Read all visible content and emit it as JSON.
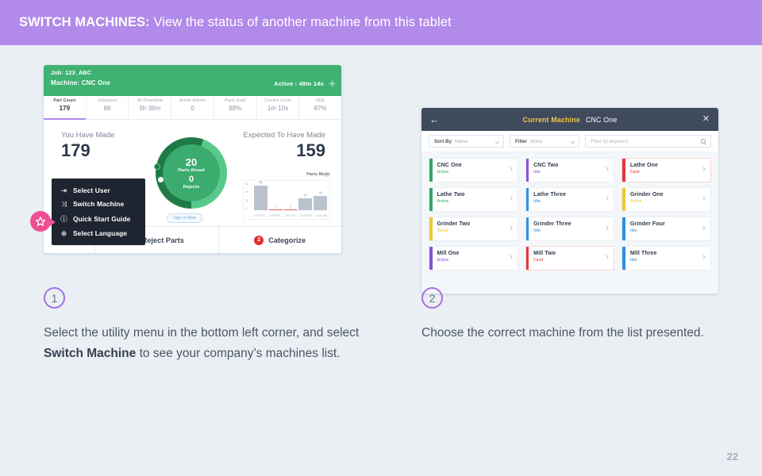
{
  "banner": {
    "strong": "SWITCH MACHINES:",
    "rest": " View the status of another machine from this tablet",
    "bg_color": "#b28ae9"
  },
  "page_number": "22",
  "left_screenshot": {
    "header": {
      "job": "Job: 123_ABC",
      "machine": "Machine: CNC One",
      "active": "Active : 48m 14s",
      "bg_color": "#3fb272"
    },
    "kpis": [
      {
        "label": "Part Count",
        "value": "179",
        "active": true
      },
      {
        "label": "Utilization",
        "value": "86",
        "active": false
      },
      {
        "label": "All Downtime",
        "value": "5h 36m",
        "active": false
      },
      {
        "label": "Active Alarms",
        "value": "0",
        "active": false
      },
      {
        "label": "Parts Goal",
        "value": "88%",
        "active": false
      },
      {
        "label": "Current Cycle",
        "value": "1m 10s",
        "active": false
      },
      {
        "label": "OEE",
        "value": "87%",
        "active": false
      }
    ],
    "made": {
      "label": "You Have Made",
      "value": "179"
    },
    "expected": {
      "label": "Expected To Have Made",
      "value": "159"
    },
    "donut": {
      "ahead_value": "20",
      "ahead_label": "Parts Ahead",
      "rejects_value": "0",
      "rejects_label": "Rejects",
      "sign_in": "Sign In Now"
    },
    "utility_menu": {
      "items": [
        {
          "icon": "login-arrow-icon",
          "glyph": "⇥",
          "label": "Select User"
        },
        {
          "icon": "shuffle-icon",
          "glyph": "⤨",
          "label": "Switch Machine"
        },
        {
          "icon": "info-circle-icon",
          "glyph": "ⓘ",
          "label": "Quick Start Guide"
        },
        {
          "icon": "globe-icon",
          "glyph": "⊕",
          "label": "Select Language"
        }
      ]
    },
    "footer": {
      "reject_label": "Reject Parts",
      "categorize_label": "Categorize",
      "categorize_badge": "2"
    },
    "chart_data": {
      "type": "bar",
      "title": "Parts Made",
      "categories": [
        "1:00 PM",
        "4:00 PM",
        "7:00 PM",
        "10:00 PM",
        "1:00 AM"
      ],
      "values": [
        45,
        1,
        1,
        22,
        26
      ],
      "bar_labels": [
        "45",
        "1",
        "1",
        "22",
        "26"
      ],
      "yticks": [
        "50",
        "30",
        "10",
        "0"
      ],
      "ylim": [
        0,
        50
      ],
      "xlabel": "",
      "ylabel": "",
      "grid": false,
      "legend": "none"
    }
  },
  "right_screenshot": {
    "header": {
      "back_icon": "back-arrow-icon",
      "current_label": "Current Machine",
      "current_machine": "CNC One",
      "close_icon": "close-icon",
      "bg_color": "#3f4a5c",
      "accent_color": "#f2c94c"
    },
    "filters": {
      "sort_label": "Sort By",
      "sort_value": "Name",
      "filter_label": "Filter",
      "filter_value": "None",
      "keyword_placeholder": "Filter by keyword"
    },
    "machines": [
      {
        "name": "CNC One",
        "status": "Active",
        "color": "#2eaa62"
      },
      {
        "name": "CNC Two",
        "status": "Idle",
        "color": "#8a4fd8"
      },
      {
        "name": "Lathe One",
        "status": "Fault",
        "color": "#e8353a"
      },
      {
        "name": "Lathe Two",
        "status": "Active",
        "color": "#2eaa62"
      },
      {
        "name": "Lathe Three",
        "status": "Idle",
        "color": "#2f8fe0"
      },
      {
        "name": "Grinder One",
        "status": "Active",
        "color": "#efc834"
      },
      {
        "name": "Grinder Two",
        "status": "Setup",
        "color": "#efc834"
      },
      {
        "name": "Grinder Three",
        "status": "Idle",
        "color": "#2f8fe0"
      },
      {
        "name": "Grinder Four",
        "status": "Idle",
        "color": "#2f8fe0"
      },
      {
        "name": "Mill One",
        "status": "Active",
        "color": "#8a4fd8"
      },
      {
        "name": "Mill Two",
        "status": "Fault",
        "color": "#e8353a"
      },
      {
        "name": "Mill Three",
        "status": "Idle",
        "color": "#2f8fe0"
      }
    ]
  },
  "captions": [
    {
      "number": "1",
      "pre": "Select the utility menu in the bottom left corner, and select ",
      "bold": "Switch Machine",
      "post": " to see your company’s machines list."
    },
    {
      "number": "2",
      "pre": "Choose the correct machine from the list presented.",
      "bold": "",
      "post": ""
    }
  ]
}
